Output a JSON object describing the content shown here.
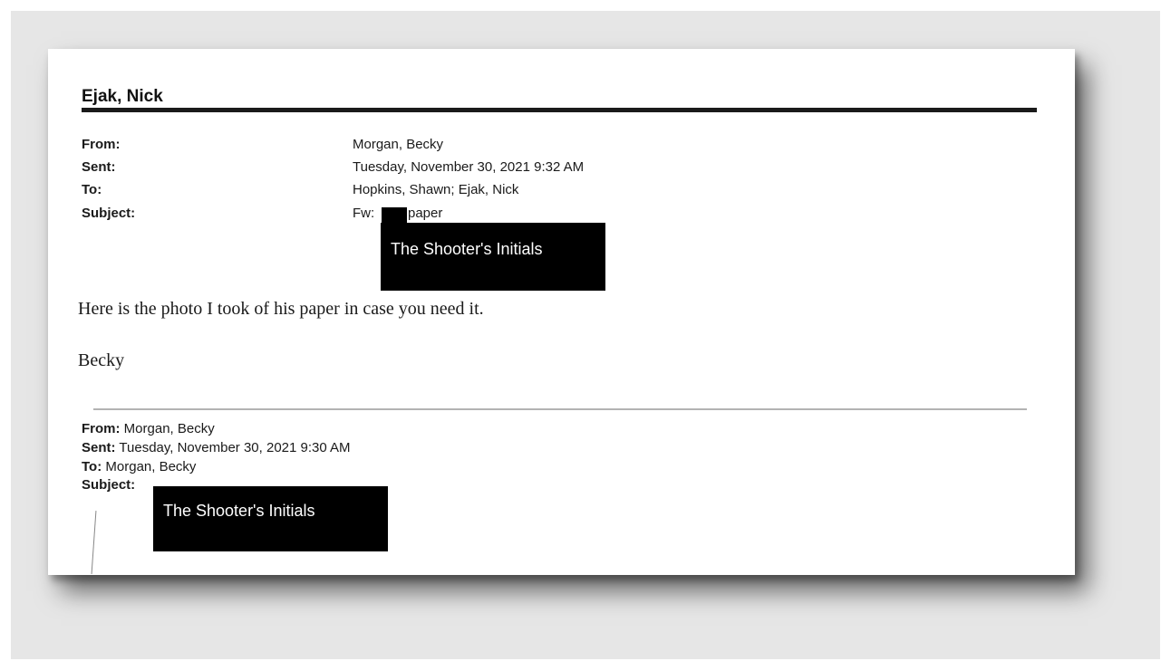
{
  "document": {
    "title": "Ejak, Nick",
    "header": {
      "from_label": "From:",
      "from_value": "Morgan, Becky",
      "sent_label": "Sent:",
      "sent_value": "Tuesday, November 30, 2021 9:32 AM",
      "to_label": "To:",
      "to_value": "Hopkins, Shawn; Ejak, Nick",
      "subject_label": "Subject:",
      "subject_prefix": "Fw:",
      "subject_suffix": "paper",
      "redaction_label": "The Shooter's Initials"
    },
    "body": {
      "line1": "Here is the photo I took of his paper in case you need it.",
      "signature": "Becky"
    },
    "forwarded": {
      "from_label": "From:",
      "from_value": "Morgan, Becky",
      "sent_label": "Sent:",
      "sent_value": "Tuesday, November 30, 2021 9:30 AM",
      "to_label": "To:",
      "to_value": "Morgan, Becky",
      "subject_label": "Subject:",
      "redaction_label": "The Shooter's Initials"
    }
  }
}
